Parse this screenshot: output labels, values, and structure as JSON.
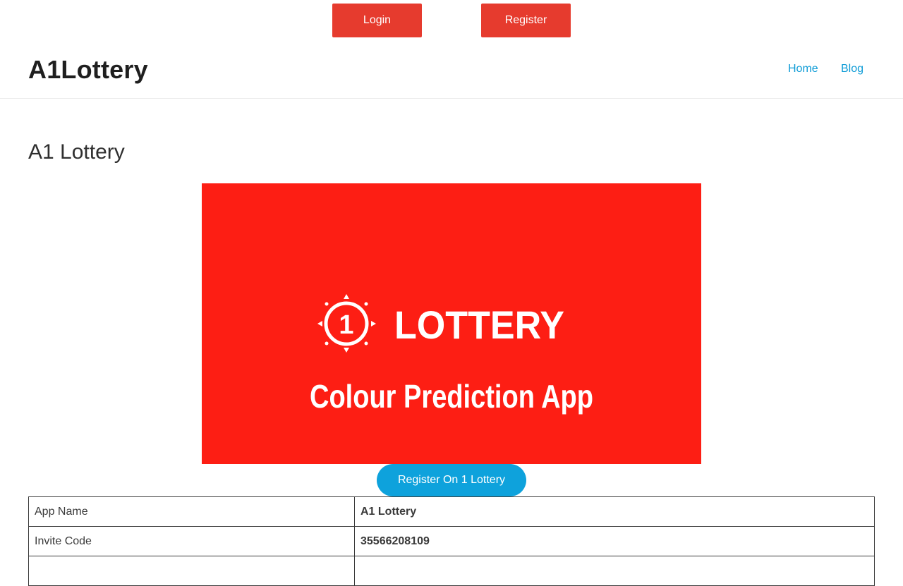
{
  "top_buttons": {
    "login": "Login",
    "register": "Register"
  },
  "header": {
    "site_title": "A1Lottery",
    "nav": [
      "Home",
      "Blog"
    ]
  },
  "page": {
    "title": "A1 Lottery"
  },
  "banner": {
    "logo_digit": "1",
    "logo_text": "LOTTERY",
    "tagline": "Colour Prediction App",
    "bg_color": "#fd1e14"
  },
  "cta": {
    "label": "Register On 1 Lottery"
  },
  "info_table": {
    "rows": [
      {
        "label": "App Name",
        "value": "A1 Lottery"
      },
      {
        "label": "Invite Code",
        "value": "35566208109"
      },
      {
        "label": "",
        "value": ""
      }
    ]
  },
  "colors": {
    "button_red": "#e63b2e",
    "link_blue": "#0d9bd6",
    "cta_blue": "#0ea2dc"
  }
}
